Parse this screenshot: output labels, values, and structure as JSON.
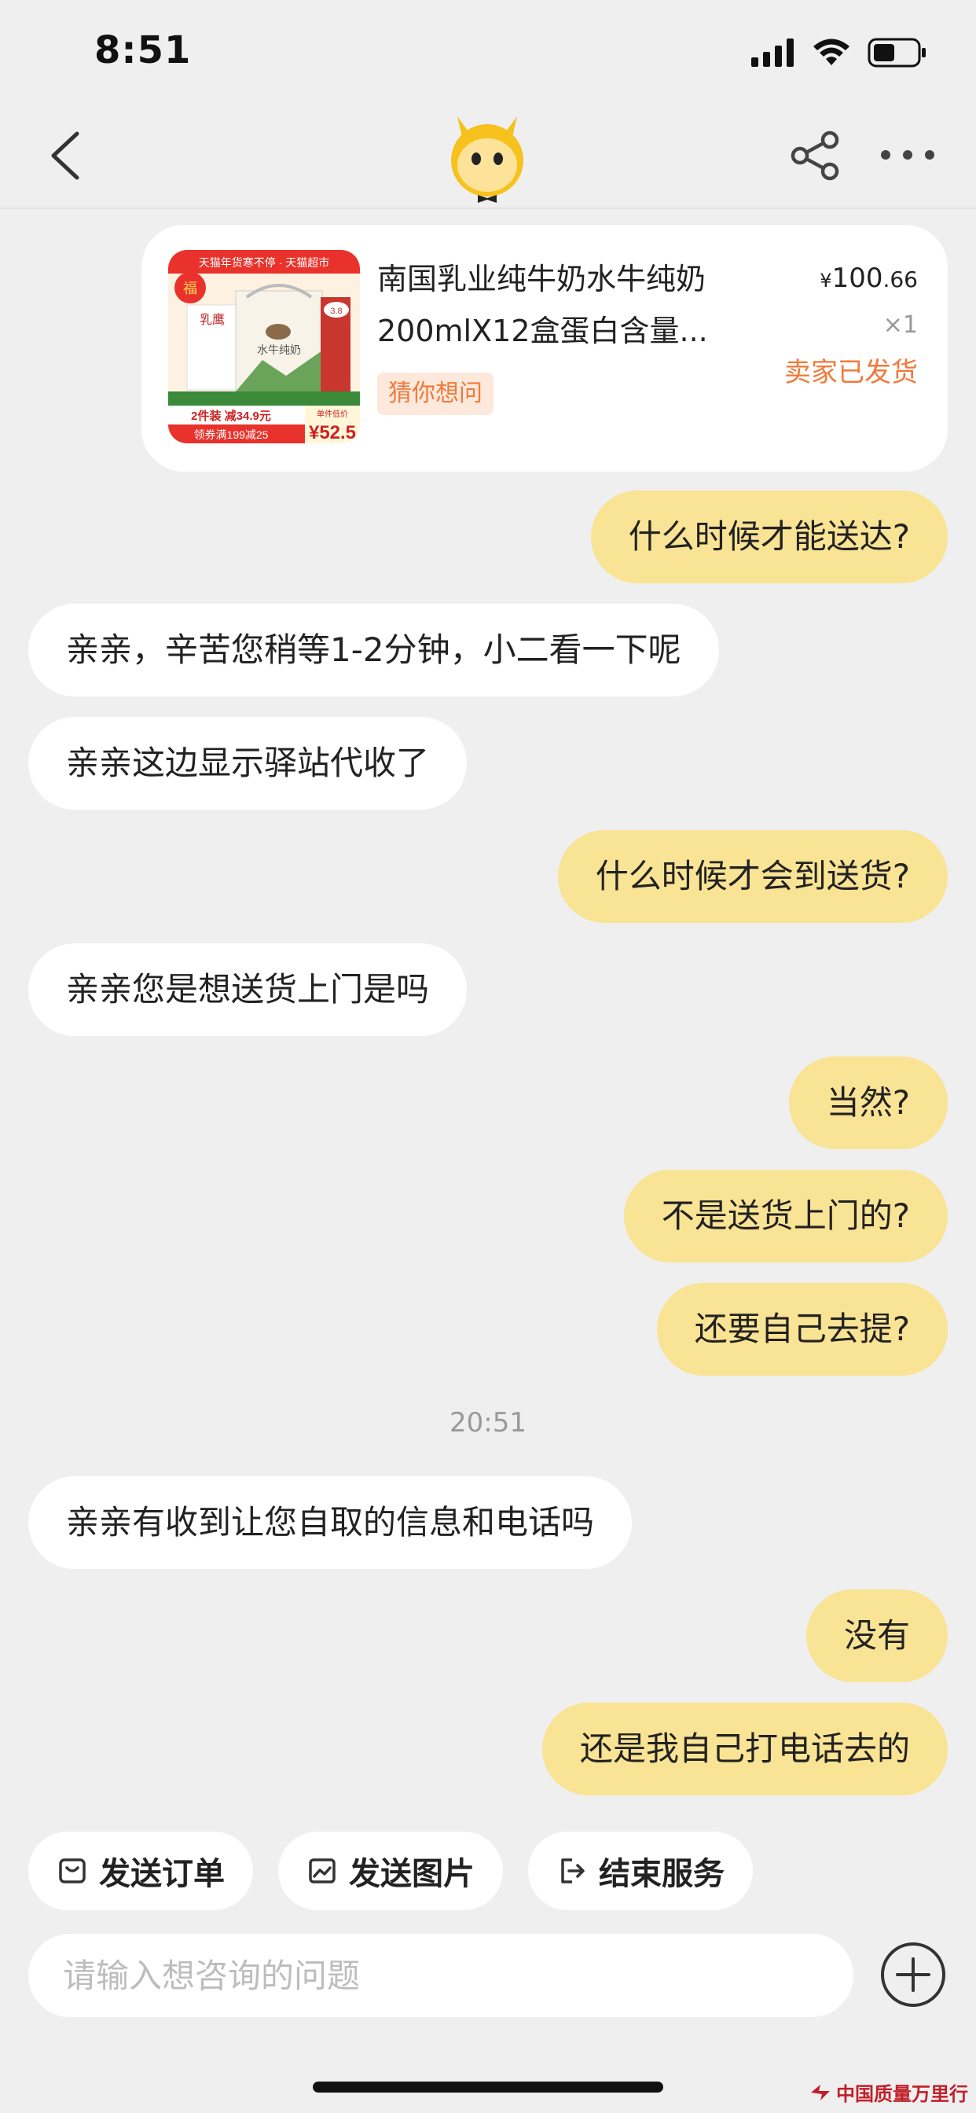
{
  "status_bar": {
    "time": "8:51"
  },
  "product": {
    "title_line1": "南国乳业纯牛奶水牛纯奶",
    "title_line2": "200mlX12盒蛋白含量...",
    "tag": "猜你想问",
    "price_currency": "¥",
    "price_int": "100",
    "price_dec": ".66",
    "quantity": "×1",
    "status": "卖家已发货",
    "image_texts": {
      "banner": "天猫年货寒不停 · 天猫超市",
      "brand": "乳鹰",
      "name": "水牛纯奶",
      "promo1": "2件装 减34.9元",
      "promo2": "领券满199减25",
      "price_label": "单件低价",
      "price": "¥52.5"
    }
  },
  "messages": [
    {
      "side": "me",
      "text": "什么时候才能送达?"
    },
    {
      "side": "them",
      "text": "亲亲，辛苦您稍等1-2分钟，小二看一下呢"
    },
    {
      "side": "them",
      "text": "亲亲这边显示驿站代收了"
    },
    {
      "side": "me",
      "text": "什么时候才会到送货?"
    },
    {
      "side": "them",
      "text": "亲亲您是想送货上门是吗"
    },
    {
      "side": "me",
      "text": "当然?"
    },
    {
      "side": "me",
      "text": "不是送货上门的?"
    },
    {
      "side": "me",
      "text": "还要自己去提?"
    },
    {
      "side": "them",
      "text": "亲亲有收到让您自取的信息和电话吗"
    },
    {
      "side": "me",
      "text": "没有"
    },
    {
      "side": "me",
      "text": "还是我自己打电话去的"
    }
  ],
  "timestamp": "20:51",
  "quick_actions": [
    {
      "label": "发送订单",
      "icon": "order-icon"
    },
    {
      "label": "发送图片",
      "icon": "image-icon"
    },
    {
      "label": "结束服务",
      "icon": "exit-icon"
    }
  ],
  "input": {
    "placeholder": "请输入想咨询的问题",
    "value": ""
  },
  "watermark": "中国质量万里行",
  "colors": {
    "background": "#efefef",
    "my_bubble": "#f9e394",
    "their_bubble": "#ffffff",
    "accent_orange": "#f07a3a"
  }
}
